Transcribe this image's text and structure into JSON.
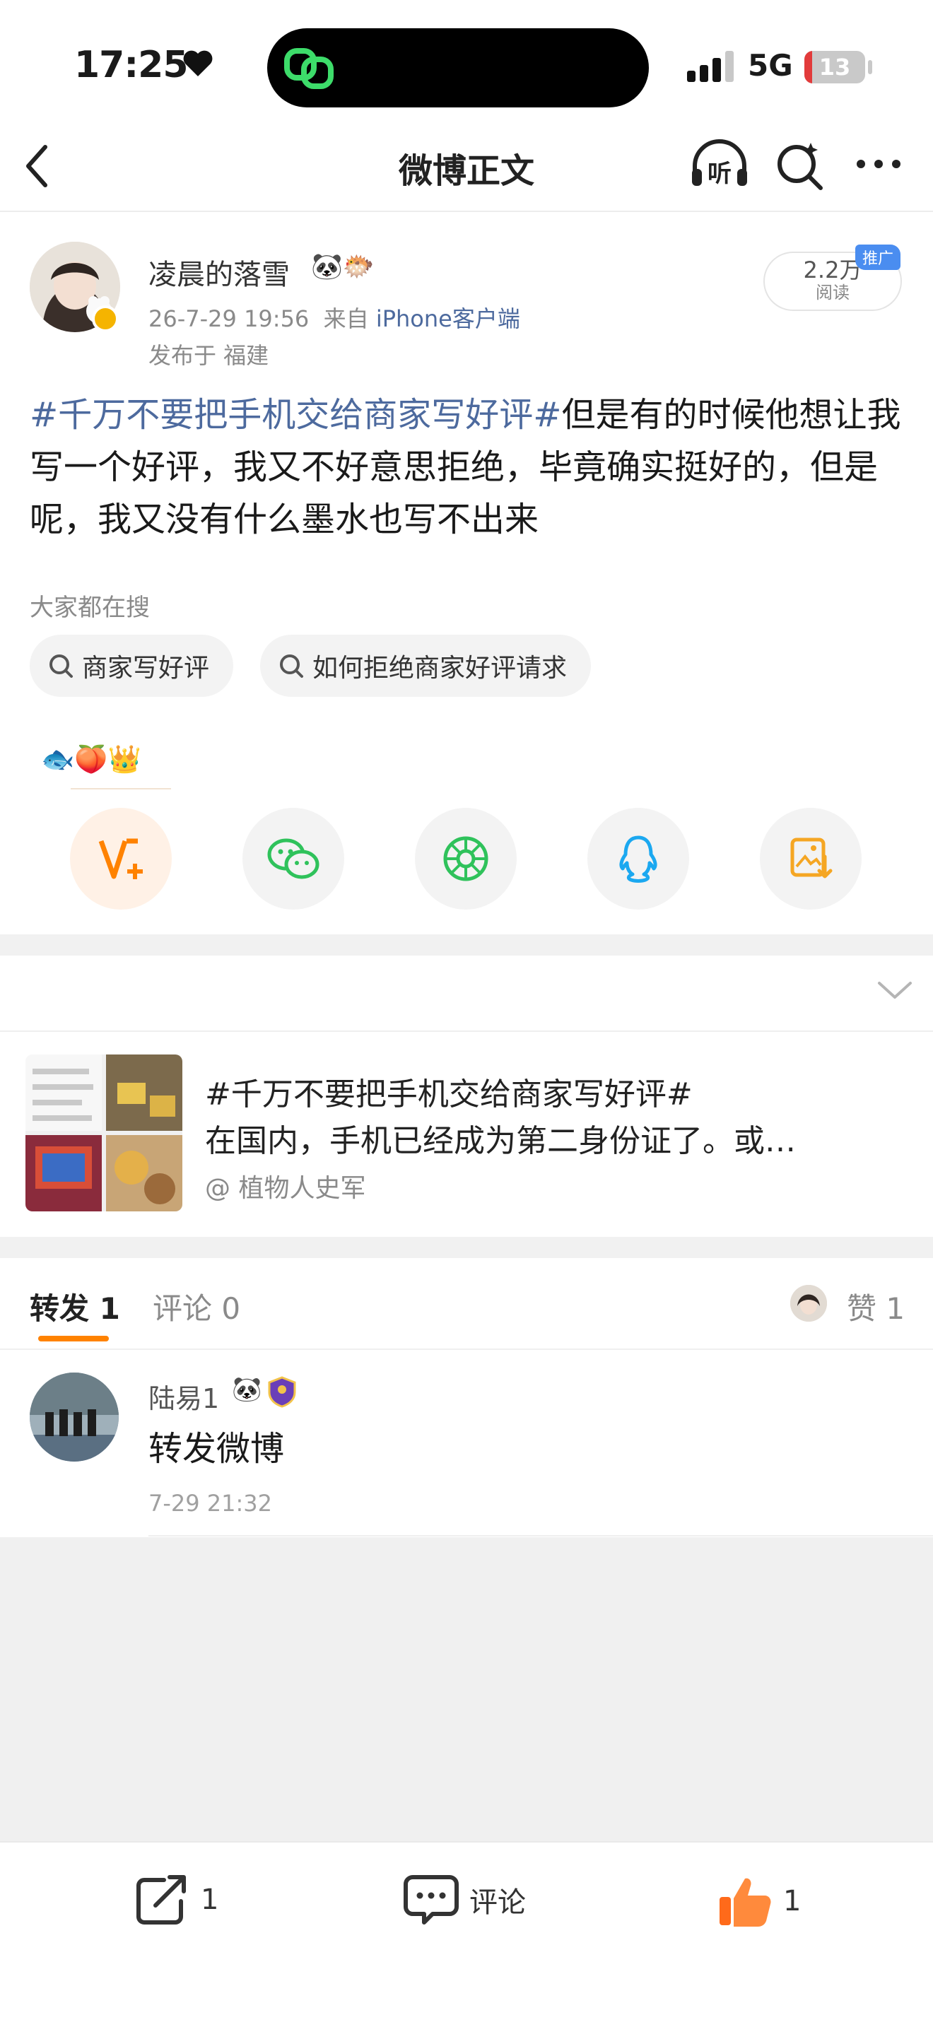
{
  "status_bar": {
    "time": "17:25",
    "network": "5G",
    "battery": "13",
    "battery_level_percent": 13,
    "icons": [
      "heart-icon",
      "island-app-icon",
      "signal-icon",
      "battery-icon"
    ]
  },
  "nav": {
    "title": "微博正文",
    "icons": [
      "back-icon",
      "listen-icon",
      "search-icon",
      "more-icon"
    ],
    "listen_glyph": "听"
  },
  "post": {
    "author": "凌晨的落雪",
    "author_emoji": "🐼🐡",
    "date": "26-7-29 19:56",
    "source_prefix": "来自",
    "source": "iPhone客户端",
    "location": "发布于 福建",
    "reads_count": "2.2万",
    "reads_label": "阅读",
    "promo_tag": "推广",
    "hashtag": "#千万不要把手机交给商家写好评#",
    "text": "但是有的时候他想让我写一个好评，我又不好意思拒绝，毕竟确实挺好的，但是呢，我又没有什么墨水也写不出来"
  },
  "search_suggest": {
    "heading": "大家都在搜",
    "chips": [
      {
        "label": "商家写好评"
      },
      {
        "label": "如何拒绝商家好评请求"
      }
    ]
  },
  "reactions": {
    "emojis": "🐟🍑👑"
  },
  "share_targets": [
    {
      "name": "vplus-icon"
    },
    {
      "name": "wechat-icon"
    },
    {
      "name": "moments-icon"
    },
    {
      "name": "qq-icon"
    },
    {
      "name": "save-image-icon"
    }
  ],
  "related": {
    "title": "#千万不要把手机交给商家写好评#",
    "excerpt": "在国内，手机已经成为第二身份证了。或…",
    "author": "@ 植物人史军"
  },
  "tabs": {
    "repost_label": "转发",
    "repost_count": "1",
    "comment_label": "评论",
    "comment_count": "0",
    "like_label": "赞",
    "like_count": "1"
  },
  "repost_item": {
    "name": "陆易1",
    "emoji": "🐼",
    "text": "转发微博",
    "time": "7-29 21:32"
  },
  "bottom_bar": {
    "repost_count": "1",
    "comment_label": "评论",
    "like_count": "1"
  },
  "colors": {
    "accent": "#ff8200",
    "link": "#4d6a9e",
    "verified": "#f5b400",
    "wechat": "#2fc25b",
    "qq": "#1ba8f0",
    "save": "#f5a623"
  }
}
